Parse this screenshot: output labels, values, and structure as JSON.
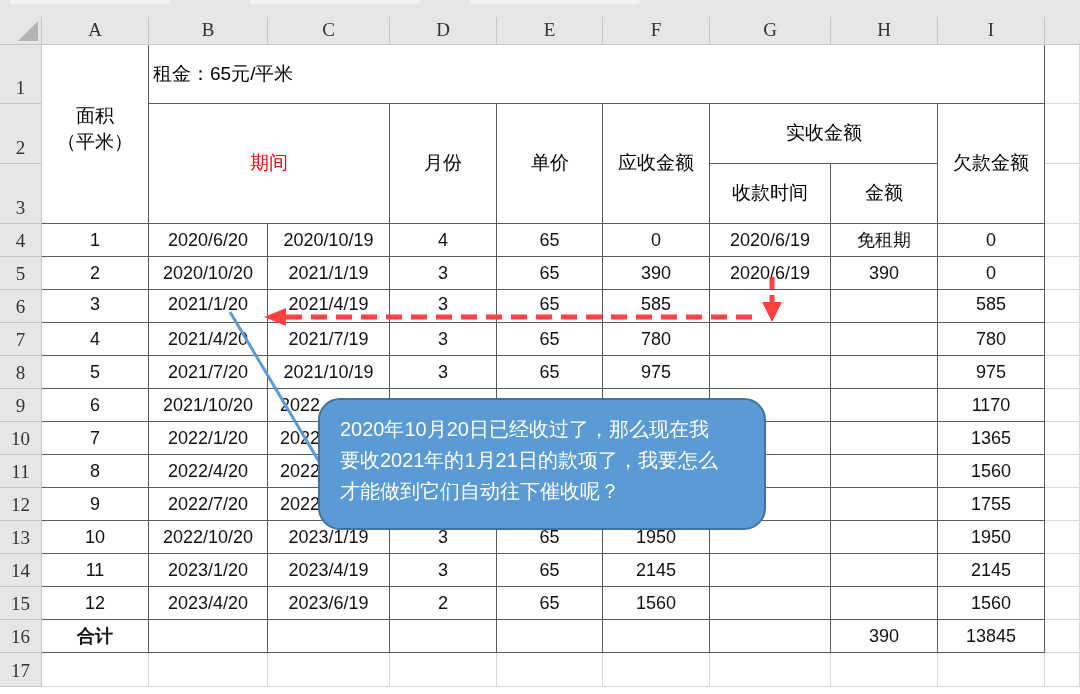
{
  "column_headers": [
    "A",
    "B",
    "C",
    "D",
    "E",
    "F",
    "G",
    "H",
    "I"
  ],
  "row_numbers": [
    "1",
    "2",
    "3",
    "4",
    "5",
    "6",
    "7",
    "8",
    "9",
    "10",
    "11",
    "12",
    "13",
    "14",
    "15",
    "16",
    "17"
  ],
  "title_cell": "租金：65元/平米",
  "header": {
    "area_lines": [
      "面积",
      "（平米）"
    ],
    "period": "期间",
    "months": "月份",
    "price": "单价",
    "receivable": "应收金额",
    "received": "实收金额",
    "received_date": "收款时间",
    "received_amount": "金额",
    "arrears": "欠款金额"
  },
  "rows": [
    {
      "kind": "full",
      "cells": [
        "1",
        "2020/6/20",
        "2020/10/19",
        "4",
        "65",
        "0",
        "2020/6/19",
        "免租期",
        "0"
      ]
    },
    {
      "kind": "full",
      "cells": [
        "2",
        "2020/10/20",
        "2021/1/19",
        "3",
        "65",
        "390",
        "2020/6/19",
        "390",
        "0"
      ]
    },
    {
      "kind": "arrowed",
      "cells": [
        "3",
        "2021/1/20",
        "2021/4/19",
        "3",
        "65",
        "585",
        null,
        null,
        "585"
      ]
    },
    {
      "kind": "full",
      "cells": [
        "4",
        "2021/4/20",
        "2021/7/19",
        "3",
        "65",
        "780",
        null,
        null,
        "780"
      ]
    },
    {
      "kind": "full",
      "cells": [
        "5",
        "2021/7/20",
        "2021/10/19",
        "3",
        "65",
        "975",
        null,
        null,
        "975"
      ]
    },
    {
      "kind": "covered",
      "cells": [
        "6",
        "2021/10/20",
        "2022",
        null,
        null,
        null,
        null,
        null,
        "1170"
      ]
    },
    {
      "kind": "covered",
      "cells": [
        "7",
        "2022/1/20",
        "2022",
        null,
        null,
        null,
        null,
        null,
        "1365"
      ]
    },
    {
      "kind": "covered",
      "cells": [
        "8",
        "2022/4/20",
        "2022",
        null,
        null,
        null,
        null,
        null,
        "1560"
      ]
    },
    {
      "kind": "covered",
      "cells": [
        "9",
        "2022/7/20",
        "2022",
        null,
        null,
        null,
        null,
        null,
        "1755"
      ]
    },
    {
      "kind": "full",
      "cells": [
        "10",
        "2022/10/20",
        "2023/1/19",
        "3",
        "65",
        "1950",
        null,
        null,
        "1950"
      ]
    },
    {
      "kind": "full",
      "cells": [
        "11",
        "2023/1/20",
        "2023/4/19",
        "3",
        "65",
        "2145",
        null,
        null,
        "2145"
      ]
    },
    {
      "kind": "full",
      "cells": [
        "12",
        "2023/4/20",
        "2023/6/19",
        "2",
        "65",
        "1560",
        null,
        null,
        "1560"
      ]
    },
    {
      "kind": "total",
      "cells": [
        "合计",
        null,
        null,
        null,
        null,
        null,
        null,
        "390",
        "13845"
      ]
    }
  ],
  "callout_text": "2020年10月20日已经收过了，那么现在我要收2021年的1月21日的款项了，我要怎么才能做到它们自动往下催收呢？"
}
